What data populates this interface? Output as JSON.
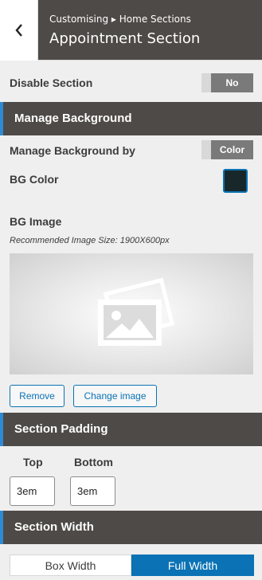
{
  "header": {
    "breadcrumb": "Customising ▸ Home Sections",
    "title": "Appointment Section",
    "back_icon": "chevron-left-icon"
  },
  "disable_section": {
    "label": "Disable Section",
    "value": "No"
  },
  "manage_background": {
    "heading": "Manage Background",
    "by_label": "Manage Background by",
    "by_value": "Color",
    "bg_color_label": "BG Color",
    "bg_color_value": "#18282a",
    "bg_image_label": "BG Image",
    "bg_image_hint": "Recommended Image Size: 1900X600px",
    "image_icon": "image-placeholder-icon",
    "remove_label": "Remove",
    "change_label": "Change image"
  },
  "section_padding": {
    "heading": "Section Padding",
    "top_label": "Top",
    "top_value": "3em",
    "bottom_label": "Bottom",
    "bottom_value": "3em"
  },
  "section_width": {
    "heading": "Section Width",
    "options": [
      "Box Width",
      "Full Width"
    ],
    "selected": "Full Width"
  },
  "colors": {
    "accent": "#0a72b5",
    "header_bg": "#4e4a47",
    "section_stripe": "#2e8bd3"
  }
}
